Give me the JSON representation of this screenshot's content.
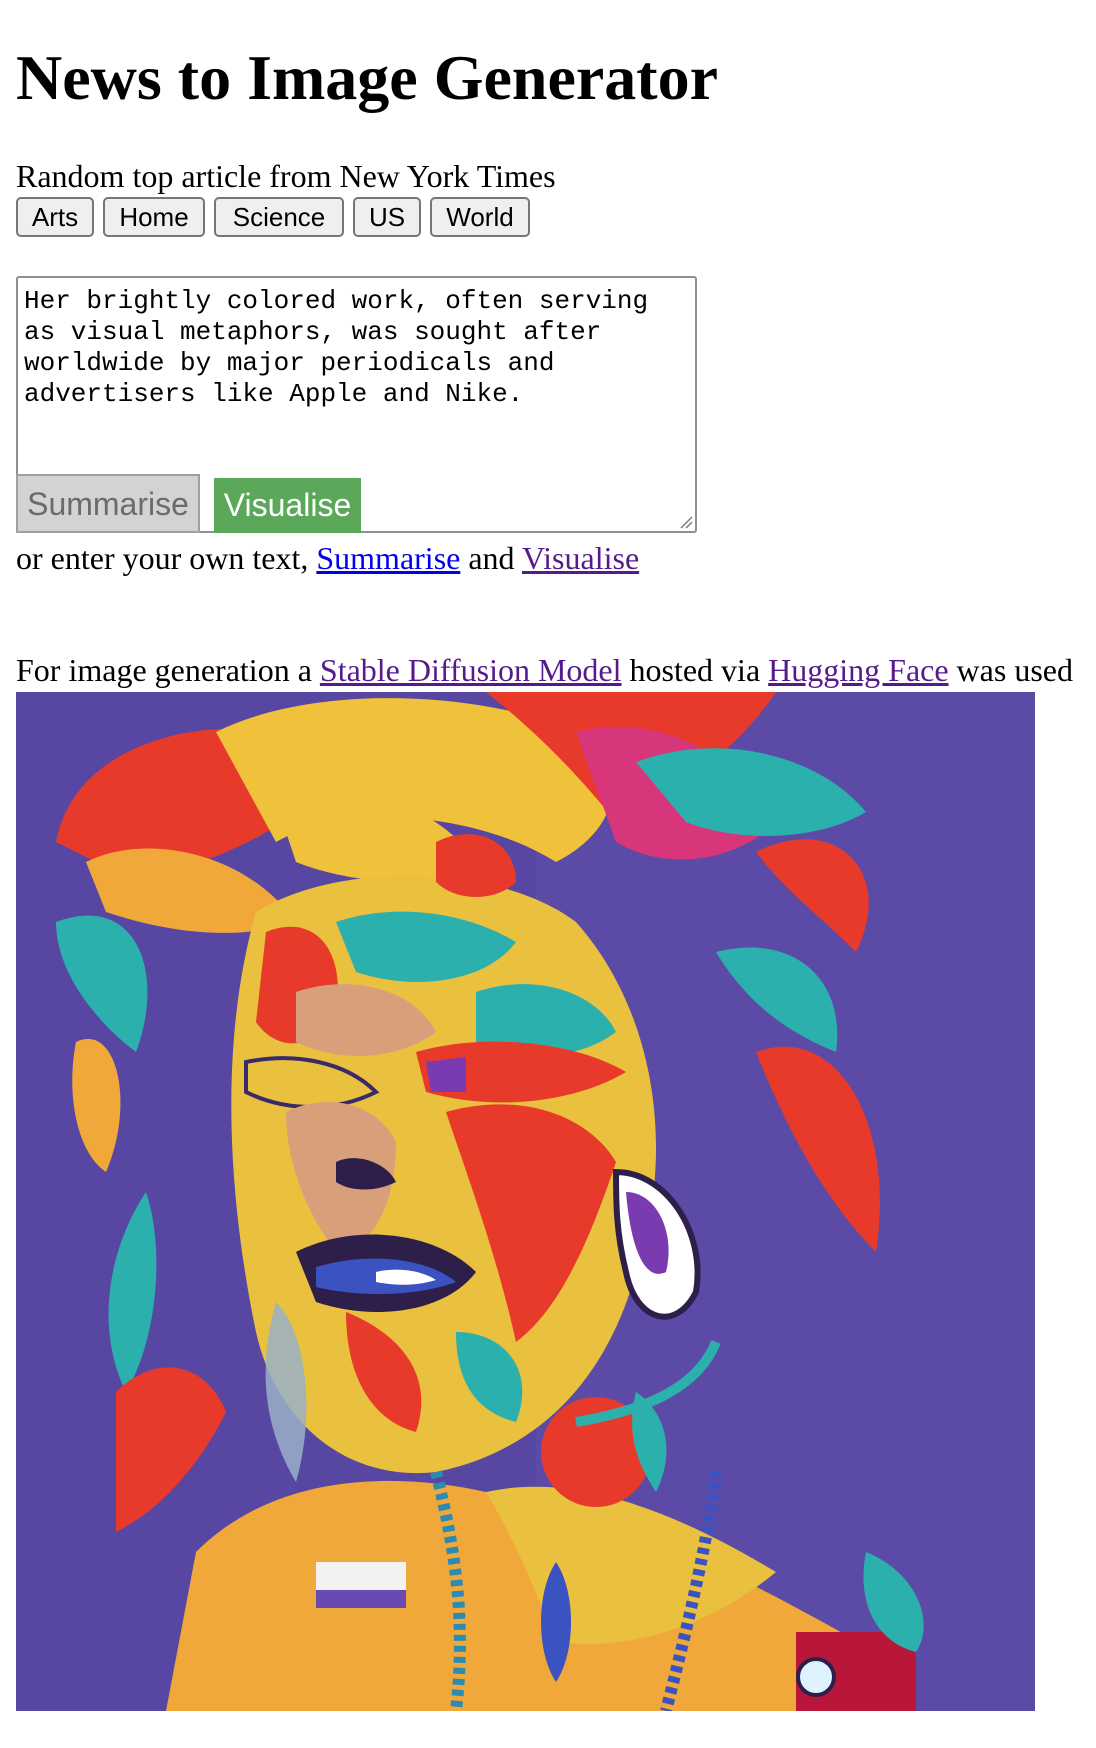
{
  "header": {
    "title": "News to Image Generator"
  },
  "intro": {
    "text": "Random top article from New York Times"
  },
  "categories": [
    {
      "label": "Arts"
    },
    {
      "label": "Home"
    },
    {
      "label": "Science"
    },
    {
      "label": "US"
    },
    {
      "label": "World"
    }
  ],
  "editor": {
    "value": "Her brightly colored work, often serving as visual metaphors, was sought after worldwide by major periodicals and advertisers like Apple and Nike.",
    "summarise_label": "Summarise",
    "visualise_label": "Visualise"
  },
  "own_text": {
    "prefix": "or enter your own text,",
    "summarise_link": "Summarise",
    "middle": "and",
    "visualise_link": "Visualise"
  },
  "credit": {
    "prefix": "For image generation a",
    "model_link": "Stable Diffusion Model",
    "middle": "hosted via",
    "host_link": "Hugging Face",
    "suffix": "was used"
  },
  "colors": {
    "visualise_bg": "#5ca85a",
    "link_blue": "#0000ee",
    "link_visited": "#551a8b",
    "art_bg": "#5b4aa6"
  }
}
